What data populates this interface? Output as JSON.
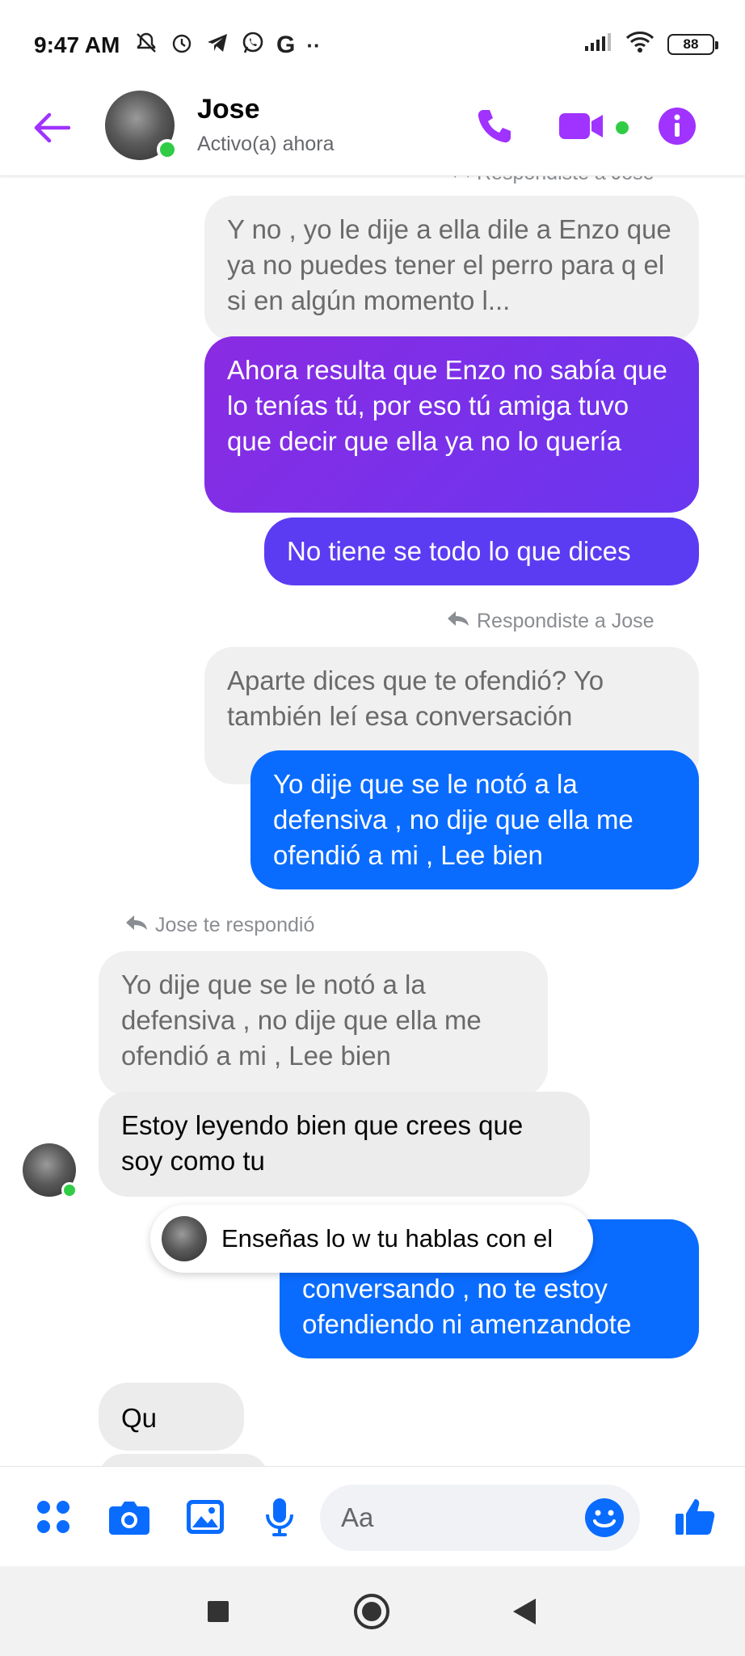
{
  "status_bar": {
    "time": "9:47 AM",
    "left_icons": [
      "mute-icon",
      "alarm-icon",
      "telegram-icon",
      "whatsapp-icon",
      "google-icon",
      "more-dots-icon"
    ],
    "battery": "88"
  },
  "header": {
    "name": "Jose",
    "status": "Activo(a) ahora",
    "accent_color": "#a033ff"
  },
  "messages": {
    "reply_note_1": "Respondiste a Jose",
    "quoted_1": "Y no , yo le dije a ella dile a Enzo que ya no puedes tener el perro para q el si en algún momento l...",
    "sent_1": "Ahora resulta que Enzo no sabía que lo tenías tú, por eso tú amiga tuvo que decir que ella ya no lo quería",
    "sent_2": "No tiene se todo lo que dices",
    "reply_note_2": "Respondiste a Jose",
    "quoted_2": "Aparte dices que te ofendió? Yo también leí esa conversación",
    "sent_3": "Yo dije que se le notó a la defensiva , no dije que ella me ofendió a mi , Lee bien",
    "reply_note_3": "Jose te respondió",
    "quoted_3": "Yo dije que se le notó a la defensiva , no dije que ella me ofendió a mi , Lee bien",
    "received_1": "Estoy leyendo bien que crees que soy como tu",
    "sent_4": "Estamos conversando, conversando , no te estoy ofendiendo ni amenzandote",
    "partial_received": "Qu"
  },
  "toast": {
    "text": "Enseñas lo w tu hablas con el"
  },
  "composer": {
    "placeholder": "Aa"
  },
  "colors": {
    "messenger_blue": "#0a6cff",
    "purple": "#8a2be2",
    "online": "#31cc46"
  }
}
